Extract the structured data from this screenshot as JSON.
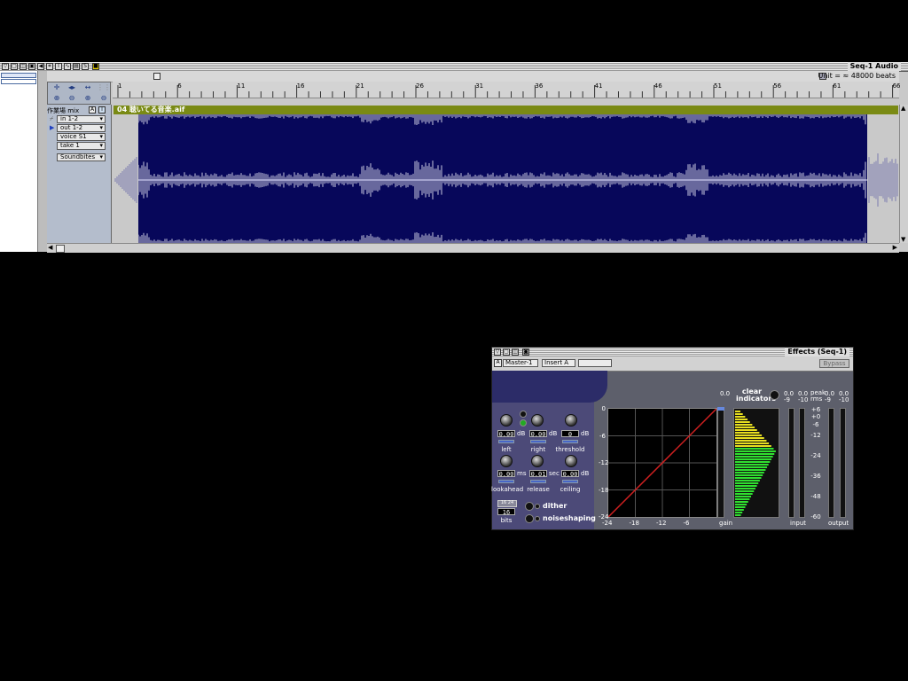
{
  "seq_window": {
    "title": "Seq-1 Audio",
    "unit_label": "Unit = ≈ 48000 beats",
    "ruler_marks": [
      "1",
      "6",
      "11",
      "16",
      "21",
      "26",
      "31",
      "36",
      "41",
      "46",
      "51",
      "56",
      "61",
      "66"
    ],
    "track": {
      "name": "作業場 mix",
      "input": "in 1-2",
      "output": "out 1-2",
      "voice": "voice S1",
      "take": "take 1",
      "soundbites": "Soundbites",
      "region_name": "04 聴いてる音楽.aif"
    }
  },
  "effects_window": {
    "title": "Effects (Seq-1)",
    "master_select": "Master-1",
    "insert_select": "Insert A",
    "bypass_label": "Bypass",
    "knobs": [
      {
        "label": "left",
        "value": "0.00",
        "unit": "dB"
      },
      {
        "label": "right",
        "value": "0.00",
        "unit": "dB"
      },
      {
        "label": "threshold",
        "value": "0",
        "unit": "dB"
      },
      {
        "label": "lookahead",
        "value": "0.00",
        "unit": "ms"
      },
      {
        "label": "release",
        "value": "0.01",
        "unit": "sec"
      },
      {
        "label": "ceiling",
        "value": "0.00",
        "unit": "dB"
      }
    ],
    "bits_value": "16",
    "bits_label": "bits",
    "bits_small": "16 24",
    "dither_label": "dither",
    "noiseshaping_label": "noiseshaping",
    "clear_indicators": "clear indicators",
    "graph_y_labels": [
      "0",
      "-6",
      "-12",
      "-18",
      "-24"
    ],
    "graph_x_labels": [
      "-24",
      "-18",
      "-12",
      "-6"
    ],
    "gain_readout": "0.0",
    "gain_label": "gain",
    "meter_scale": [
      "+6",
      "+0",
      "-6",
      "-12",
      "-24",
      "-36",
      "-48",
      "-60"
    ],
    "input_readouts": [
      "0.0",
      "-9",
      "0.0",
      "-10"
    ],
    "peak_rms_label": "peak rms",
    "output_readouts": [
      "0.0",
      "-9",
      "0.0",
      "-10"
    ],
    "input_label": "input",
    "output_label": "output"
  }
}
